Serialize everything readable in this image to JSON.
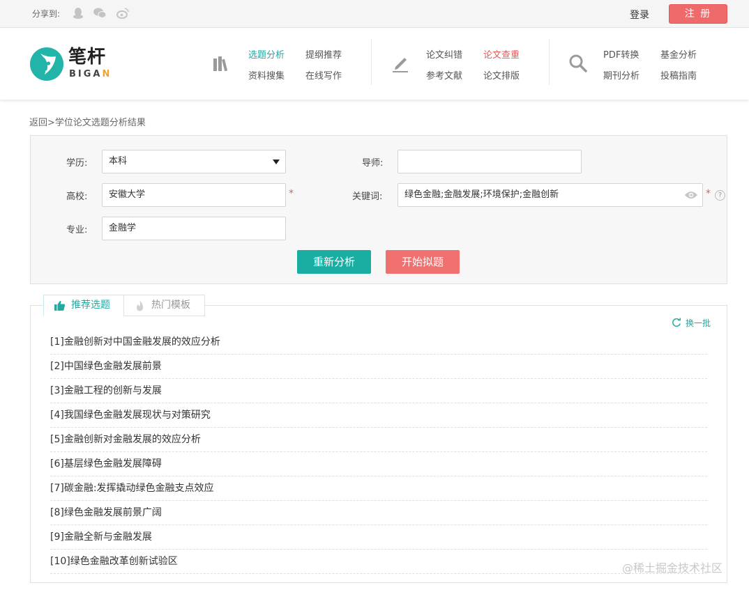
{
  "topbar": {
    "share_label": "分享到:",
    "share_icons": [
      "qq-icon",
      "wechat-icon",
      "weibo-icon"
    ],
    "login_label": "登录",
    "register_label": "注 册"
  },
  "brand": {
    "name_cn": "笔杆",
    "name_en_prefix": "BIGA",
    "name_en_suffix": "N"
  },
  "nav": {
    "groups": [
      {
        "icon": "books-icon",
        "links": [
          "选题分析",
          "提纲推荐",
          "资料搜集",
          "在线写作"
        ]
      },
      {
        "icon": "pen-icon",
        "links": [
          "论文纠错",
          "论文查重",
          "参考文献",
          "论文排版"
        ]
      },
      {
        "icon": "search-icon",
        "links": [
          "PDF转换",
          "基金分析",
          "期刊分析",
          "投稿指南"
        ]
      }
    ]
  },
  "breadcrumb": {
    "back": "返回",
    "separator": ">",
    "current": "学位论文选题分析结果"
  },
  "form": {
    "degree_label": "学历:",
    "degree_value": "本科",
    "advisor_label": "导师:",
    "advisor_value": "",
    "school_label": "高校:",
    "school_value": "安徽大学",
    "keywords_label": "关键词:",
    "keywords_value": "绿色金融;金融发展;环境保护;金融创新",
    "major_label": "专业:",
    "major_value": "金融学",
    "required_mark": "*",
    "help_mark": "?",
    "reanalyze_label": "重新分析",
    "start_label": "开始拟题"
  },
  "results": {
    "tabs": [
      "推荐选题",
      "热门模板"
    ],
    "refresh_label": "换一批",
    "topics": [
      "[1]金融创新对中国金融发展的效应分析",
      "[2]中国绿色金融发展前景",
      "[3]金融工程的创新与发展",
      "[4]我国绿色金融发展现状与对策研究",
      "[5]金融创新对金融发展的效应分析",
      "[6]基层绿色金融发展障碍",
      "[7]碳金融:发挥撬动绿色金融支点效应",
      "[8]绿色金融发展前景广阔",
      "[9]金融全新与金融发展",
      "[10]绿色金融改革创新试验区"
    ]
  },
  "watermark": "@稀土掘金技术社区",
  "colors": {
    "accent_teal": "#1aaea3",
    "accent_red": "#f07070",
    "panel_bg": "#f7f7f7"
  }
}
